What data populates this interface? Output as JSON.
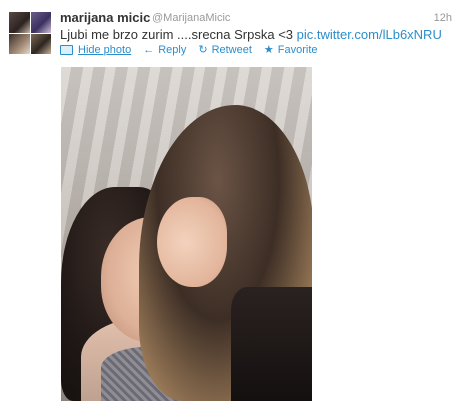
{
  "tweet": {
    "name": "marijana micic",
    "handle": "@MarijanaMicic",
    "time": "12h",
    "text_main": "Ljubi me brzo zurim ....srecna Srpska <3 ",
    "link": "pic.twitter.com/lLb6xNRU",
    "actions": {
      "hide_photo": "Hide photo",
      "reply": "Reply",
      "retweet": "Retweet",
      "favorite": "Favorite"
    }
  },
  "icons": [
    "avatar",
    "photo-icon",
    "reply-icon",
    "retweet-icon",
    "favorite-icon"
  ],
  "colors": {
    "link": "#2a8ecb",
    "name": "#333333",
    "meta": "#999999"
  }
}
